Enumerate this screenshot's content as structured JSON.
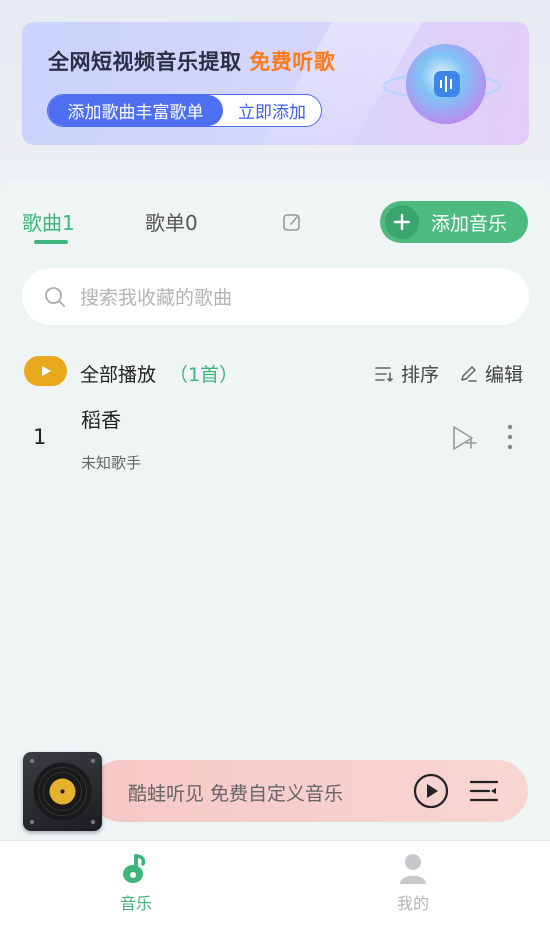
{
  "banner": {
    "title_main": "全网短视频音乐提取",
    "title_highlight": "免费听歌",
    "pill_left": "添加歌曲丰富歌单",
    "pill_right": "立即添加"
  },
  "tabs": {
    "songs": "歌曲1",
    "playlists": "歌单0"
  },
  "add_music_label": "添加音乐",
  "search": {
    "placeholder": "搜索我收藏的歌曲"
  },
  "list_header": {
    "play_all": "全部播放",
    "count": "（1首）",
    "sort": "排序",
    "edit": "编辑"
  },
  "songs": [
    {
      "index": "1",
      "title": "稻香",
      "artist": "未知歌手"
    }
  ],
  "player": {
    "text": "酷蛙听见 免费自定义音乐"
  },
  "bottom_nav": {
    "music": "音乐",
    "me": "我的"
  },
  "colors": {
    "accent_green": "#3db67b",
    "play_all_orange": "#eaa81c",
    "banner_blue": "#4f6ff3",
    "highlight_orange": "#ff7a1a"
  }
}
